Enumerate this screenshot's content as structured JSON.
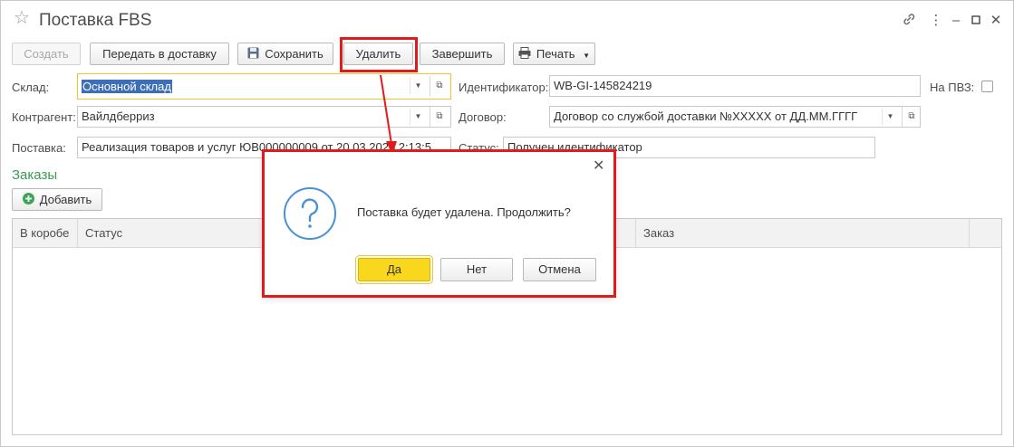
{
  "window": {
    "title": "Поставка FBS",
    "link_icon": "link-icon",
    "menu_icon": "more-icon",
    "minimize_icon": "minimize-icon",
    "maximize_icon": "maximize-icon",
    "close_icon": "close-icon"
  },
  "toolbar": {
    "create": "Создать",
    "send_to_delivery": "Передать в доставку",
    "save": "Сохранить",
    "delete": "Удалить",
    "finish": "Завершить",
    "print": "Печать"
  },
  "form": {
    "warehouse_label": "Склад:",
    "warehouse_value": "Основной склад",
    "identifier_label": "Идентификатор:",
    "identifier_value": "WB-GI-145824219",
    "pvz_label": "На ПВЗ:",
    "counterparty_label": "Контрагент:",
    "counterparty_value": "Вайлдберриз",
    "contract_label": "Договор:",
    "contract_value": "Договор со службой доставки №XXXXX от ДД.ММ.ГГГГ",
    "delivery_label": "Поставка:",
    "delivery_value": "Реализация товаров и услуг ЮВ000000009 от 20.03.2025 2:13:5",
    "status_label": "Статус:",
    "status_value": "Получен идентификатор"
  },
  "orders": {
    "section_title": "Заказы",
    "add_button": "Добавить",
    "columns": [
      "В коробе",
      "Статус",
      "Заказ"
    ]
  },
  "dialog": {
    "message": "Поставка будет удалена. Продолжить?",
    "yes": "Да",
    "no": "Нет",
    "cancel": "Отмена"
  },
  "colors": {
    "highlight": "#e11a1a",
    "primary_button": "#f9d71c",
    "section_title": "#3b9a52",
    "selection": "#3d6fb8"
  }
}
